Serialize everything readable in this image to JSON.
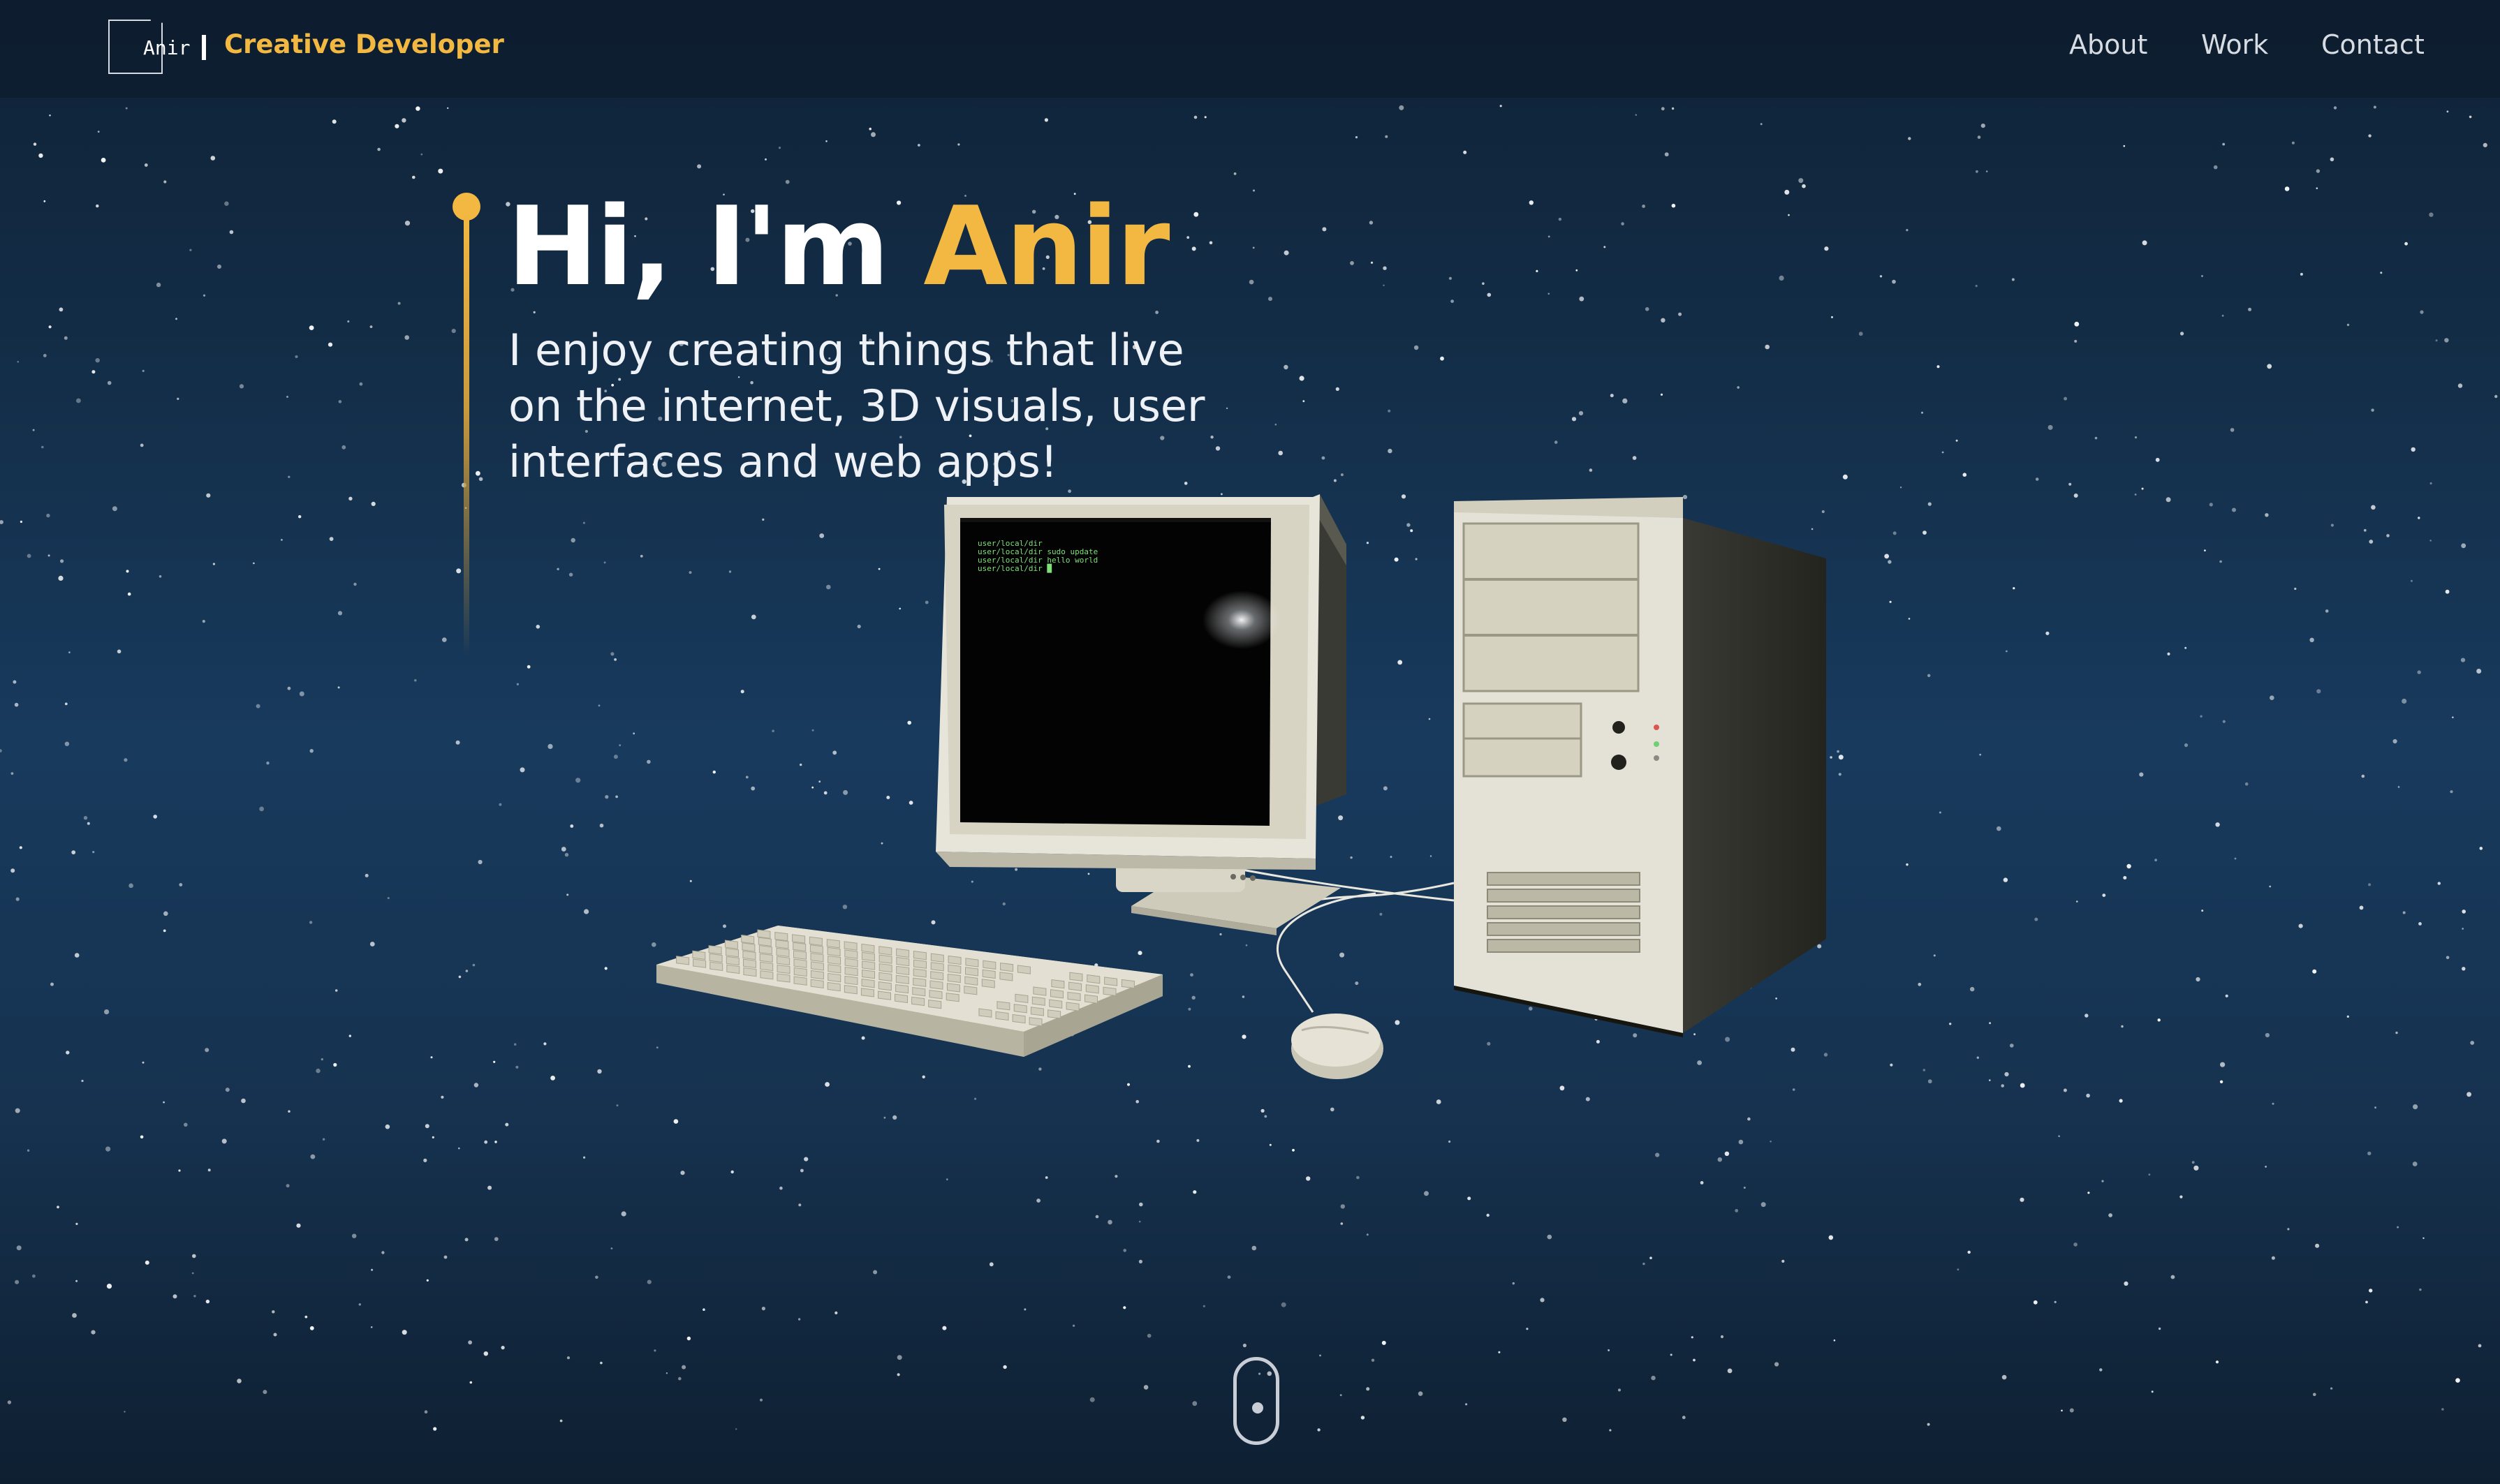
{
  "header": {
    "logo_text": "Anir",
    "tagline": "Creative Developer",
    "nav": [
      "About",
      "Work",
      "Contact"
    ]
  },
  "hero": {
    "greeting": "Hi, I'm ",
    "name": "Anir",
    "subtitle": "I enjoy creating things that live on the internet, 3D visuals, user interfaces and web apps!"
  },
  "terminal": {
    "lines": [
      "user/local/dir",
      "user/local/dir sudo update",
      "user/local/dir hello world",
      "user/local/dir █"
    ]
  },
  "colors": {
    "accent": "#f3b842",
    "terminal_text": "#7fe07a"
  },
  "icons": {
    "scroll": "mouse-scroll-icon"
  }
}
